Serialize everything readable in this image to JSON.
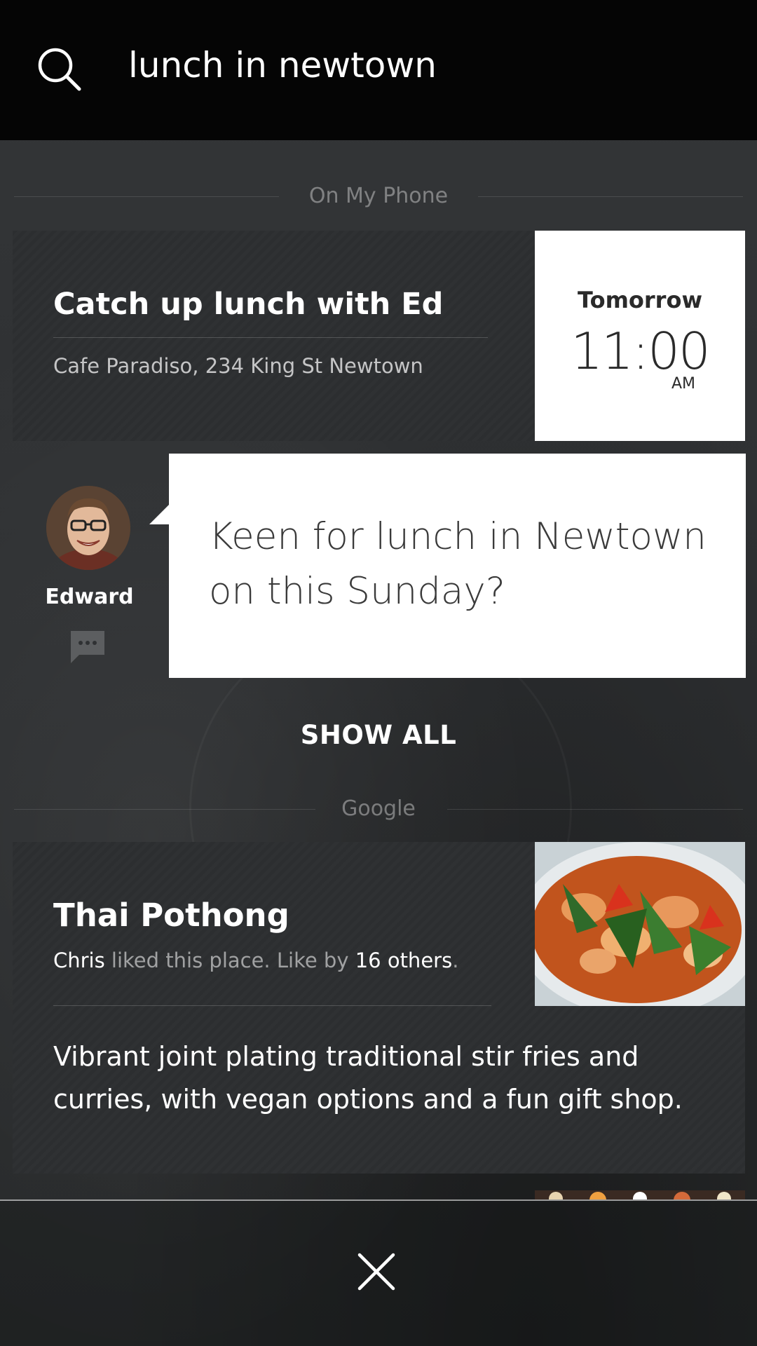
{
  "search": {
    "query": "lunch in newtown",
    "icon": "search-icon"
  },
  "sections": {
    "on_my_phone": "On My Phone",
    "google": "Google"
  },
  "calendar_event": {
    "title": "Catch up lunch with Ed",
    "location": "Cafe Paradiso, 234 King St Newtown",
    "day": "Tomorrow",
    "time": "11:00",
    "ampm": "AM"
  },
  "message": {
    "sender": "Edward",
    "text": "Keen for lunch in Newtown on this Sunday?",
    "icon": "chat-bubble-icon"
  },
  "show_all_label": "SHOW ALL",
  "place": {
    "name": "Thai Pothong",
    "social_friend": "Chris",
    "social_mid": " liked this place. Like by ",
    "social_count": "16 others",
    "social_end": ".",
    "description": "Vibrant joint plating traditional stir fries and curries, with vegan options and a fun gift shop."
  },
  "footer": {
    "close_icon": "close-icon"
  },
  "colors": {
    "header_bg": "#050505",
    "page_bg": "#2f3133",
    "card_white": "#ffffff",
    "muted_text": "#8a8c8e"
  }
}
